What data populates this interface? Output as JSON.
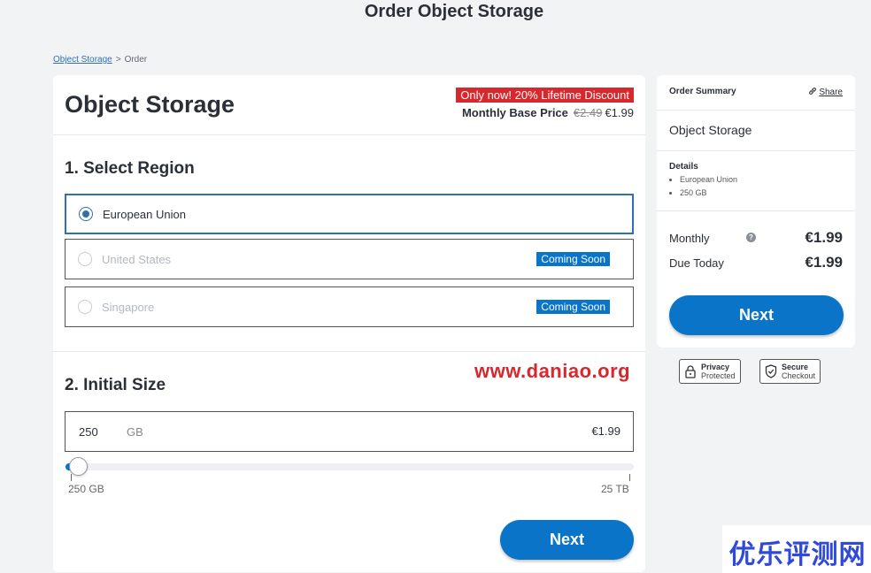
{
  "page": {
    "title": "Order Object Storage"
  },
  "breadcrumb": {
    "link": "Object Storage",
    "separator": ">",
    "current": "Order"
  },
  "product": {
    "title": "Object Storage",
    "discount_badge": "Only now! 20% Lifetime Discount",
    "base_price_label": "Monthly Base Price",
    "old_price": "€2.49",
    "new_price": "€1.99"
  },
  "region": {
    "heading": "1. Select Region",
    "options": [
      {
        "label": "European Union",
        "selected": true,
        "badge": ""
      },
      {
        "label": "United States",
        "selected": false,
        "badge": "Coming Soon"
      },
      {
        "label": "Singapore",
        "selected": false,
        "badge": "Coming Soon"
      }
    ]
  },
  "watermark": "www.daniao.org",
  "size": {
    "heading": "2. Initial Size",
    "value": "250",
    "unit": "GB",
    "price": "€1.99",
    "slider_min_label": "250 GB",
    "slider_max_label": "25 TB",
    "slider_fraction": 0.01
  },
  "main_next_label": "Next",
  "summary": {
    "heading": "Order Summary",
    "share_label": "Share",
    "product": "Object Storage",
    "details_heading": "Details",
    "details": [
      "European Union",
      "250 GB"
    ],
    "monthly_label": "Monthly",
    "monthly_value": "€1.99",
    "help_glyph": "?",
    "due_label": "Due Today",
    "due_value": "€1.99",
    "next_label": "Next"
  },
  "badges": {
    "privacy": {
      "title": "Privacy",
      "sub": "Protected",
      "icon": "lock-icon"
    },
    "secure": {
      "title": "Secure",
      "sub": "Checkout",
      "icon": "shield-check-icon"
    }
  },
  "corner_watermark": "优乐评测网",
  "colors": {
    "accent": "#0a74c9",
    "discount": "#d8282d",
    "link": "#2f6fb6"
  }
}
